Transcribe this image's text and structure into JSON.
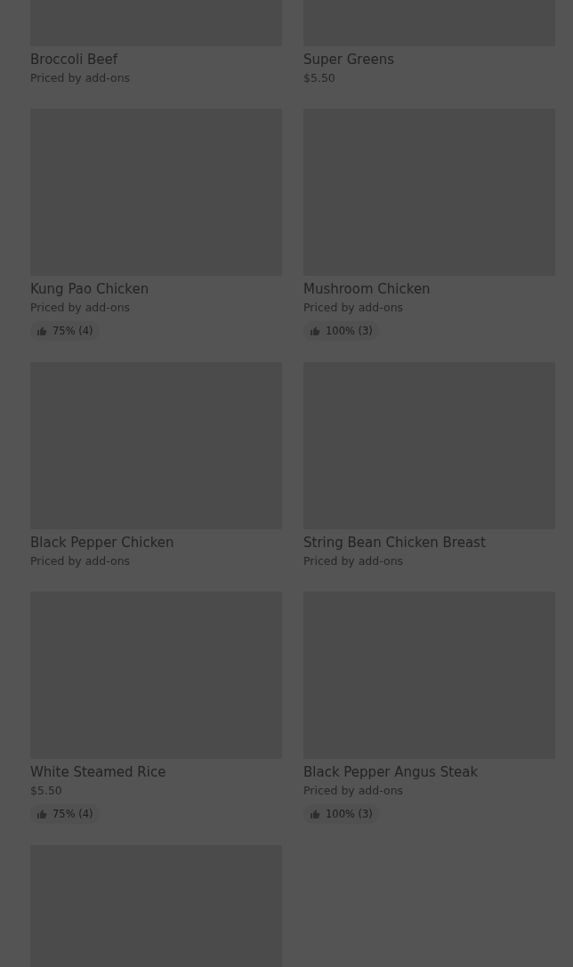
{
  "items": [
    {
      "name": "Broccoli Beef",
      "price": "Priced by add-ons"
    },
    {
      "name": "Super Greens",
      "price": "$5.50"
    },
    {
      "name": "Kung Pao Chicken",
      "price": "Priced by add-ons",
      "rating": "75% (4)"
    },
    {
      "name": "Mushroom Chicken",
      "price": "Priced by add-ons",
      "rating": "100% (3)"
    },
    {
      "name": "Black Pepper Chicken",
      "price": "Priced by add-ons"
    },
    {
      "name": "String Bean Chicken Breast",
      "price": "Priced by add-ons"
    },
    {
      "name": "White Steamed Rice",
      "price": "$5.50",
      "rating": "75% (4)"
    },
    {
      "name": "Black Pepper Angus Steak",
      "price": "Priced by add-ons",
      "rating": "100% (3)"
    },
    {
      "kind": "placeholder"
    }
  ]
}
